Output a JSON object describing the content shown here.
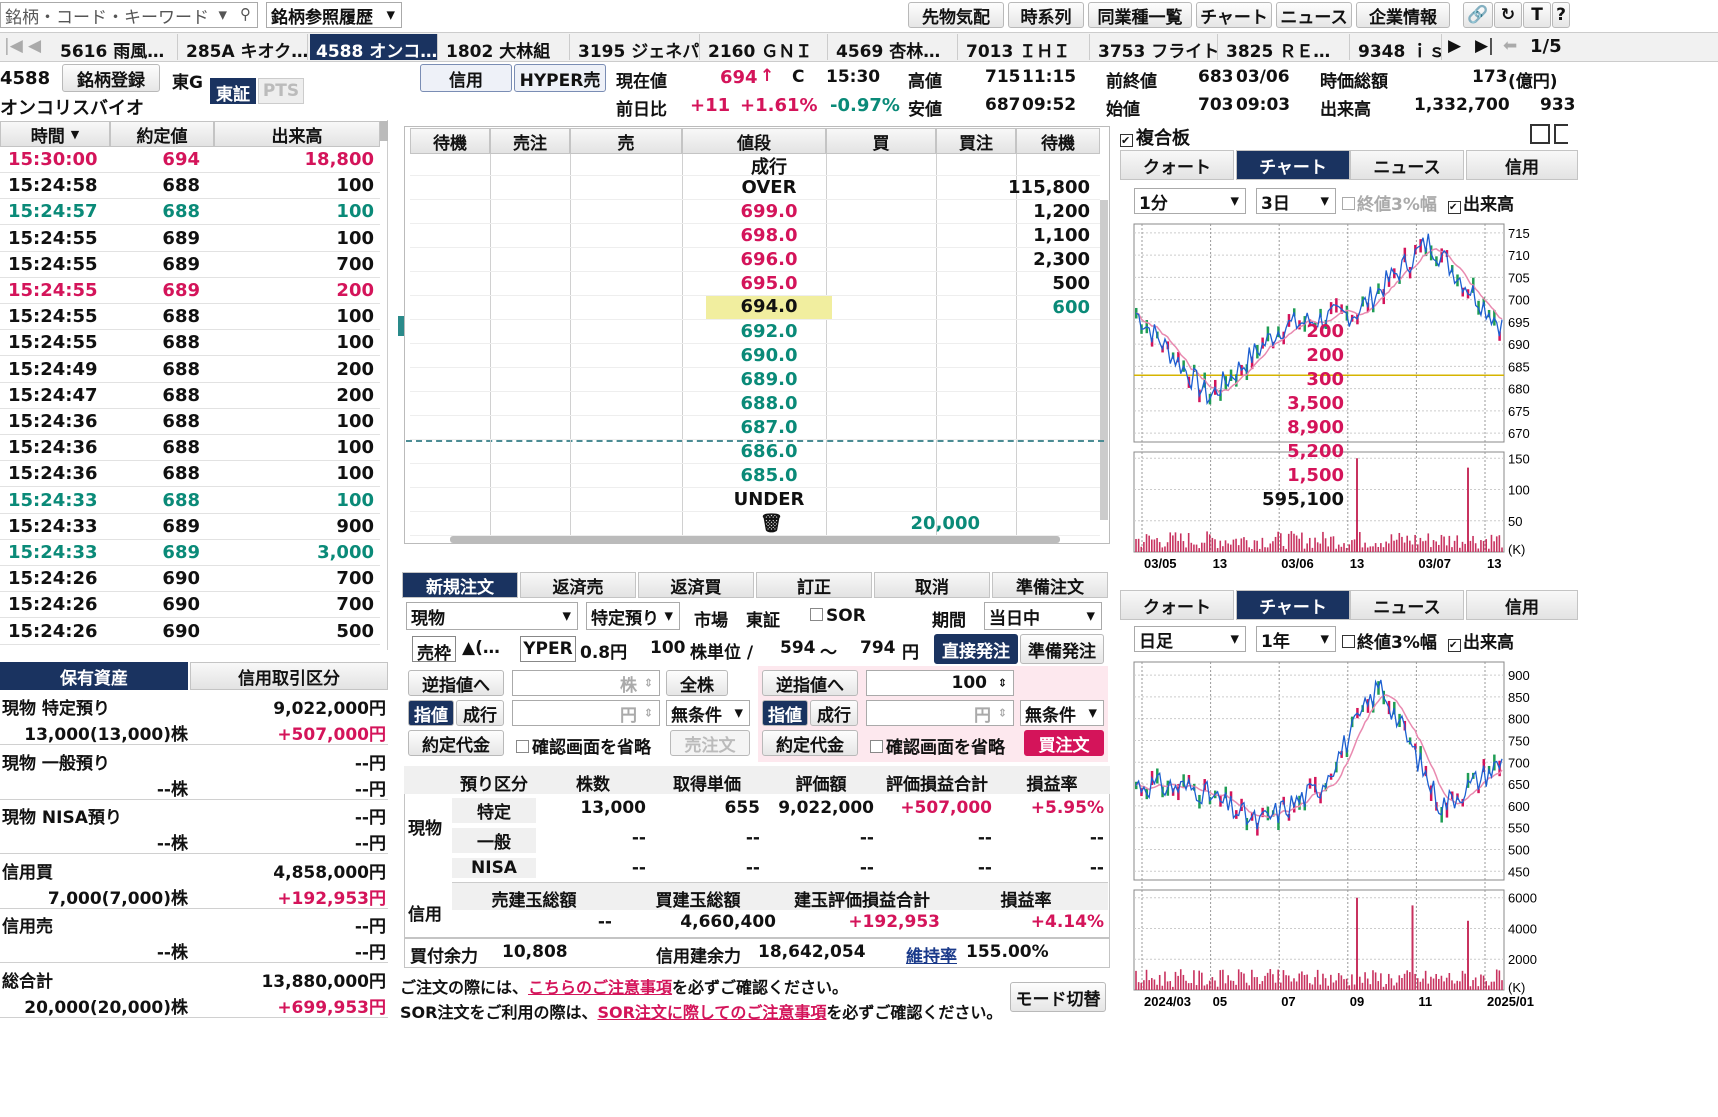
{
  "search": {
    "placeholder": "銘柄・コード・キーワード",
    "history": "銘柄参照履歴"
  },
  "topnav": [
    "先物気配",
    "時系列",
    "同業種一覧",
    "チャート",
    "ニュース",
    "企業情報"
  ],
  "tickers": [
    "5616 雨風…",
    "285A キオク…",
    "4588 オンコ…",
    "1802 大林組",
    "3195 ジェネパ",
    "2160 ＧＮＩ",
    "4569 杏林…",
    "7013 ＩＨＩ",
    "3753 フライト",
    "3825 ＲＥ…",
    "9348 ｉｓ"
  ],
  "pager": "1/5",
  "stock": {
    "code": "4588",
    "name": "オンコリスバイオ",
    "register": "銘柄登録",
    "market_label": "東G",
    "market_tab": "東証",
    "pts": "PTS",
    "credit": "信用",
    "hyper": "HYPER売"
  },
  "quote": {
    "cur_label": "現在値",
    "cur": "694",
    "cur_arrow": "↑",
    "c": "C",
    "cur_time": "15:30",
    "diff_label": "前日比",
    "diff": "+11",
    "diff_pct": "+1.61%",
    "vwap_pct": "-0.97%",
    "high_label": "高値",
    "high": "715",
    "high_time": "11:15",
    "low_label": "安値",
    "low": "687",
    "low_time": "09:52",
    "prev_label": "前終値",
    "prev": "683",
    "prev_date": "03/06",
    "open_label": "始値",
    "open": "703",
    "open_time": "09:03",
    "mcap_label": "時価総額",
    "mcap": "173",
    "mcap_unit": "(億円)",
    "vol_label": "出来高",
    "vol": "1,332,700",
    "vol_extra": "933"
  },
  "timesales": {
    "headers": [
      "時間",
      "約定値",
      "出来高"
    ],
    "rows": [
      [
        "15:30:00",
        "694",
        "18,800",
        "red"
      ],
      [
        "15:24:58",
        "688",
        "100",
        ""
      ],
      [
        "15:24:57",
        "688",
        "100",
        "grn"
      ],
      [
        "15:24:55",
        "689",
        "100",
        ""
      ],
      [
        "15:24:55",
        "689",
        "700",
        ""
      ],
      [
        "15:24:55",
        "689",
        "200",
        "red"
      ],
      [
        "15:24:55",
        "688",
        "100",
        ""
      ],
      [
        "15:24:55",
        "688",
        "100",
        ""
      ],
      [
        "15:24:49",
        "688",
        "200",
        ""
      ],
      [
        "15:24:47",
        "688",
        "200",
        ""
      ],
      [
        "15:24:36",
        "688",
        "100",
        ""
      ],
      [
        "15:24:36",
        "688",
        "100",
        ""
      ],
      [
        "15:24:36",
        "688",
        "100",
        ""
      ],
      [
        "15:24:33",
        "688",
        "100",
        "grn"
      ],
      [
        "15:24:33",
        "689",
        "900",
        ""
      ],
      [
        "15:24:33",
        "689",
        "3,000",
        "grn"
      ],
      [
        "15:24:26",
        "690",
        "700",
        ""
      ],
      [
        "15:24:26",
        "690",
        "700",
        ""
      ],
      [
        "15:24:26",
        "690",
        "500",
        ""
      ]
    ]
  },
  "board": {
    "headers": [
      "待機",
      "売注",
      "売",
      "値段",
      "買",
      "買注",
      "待機"
    ],
    "rows": [
      [
        "",
        "",
        "",
        "成行",
        "",
        ""
      ],
      [
        "",
        "",
        "115,800",
        "OVER",
        "",
        ""
      ],
      [
        "",
        "",
        "1,200",
        "699.0",
        "",
        "red"
      ],
      [
        "",
        "",
        "1,100",
        "698.0",
        "",
        "red"
      ],
      [
        "",
        "",
        "2,300",
        "696.0",
        "",
        "red"
      ],
      [
        "",
        "",
        "500",
        "695.0",
        "",
        "red"
      ],
      [
        "",
        "",
        "600",
        "694.0",
        "",
        "cur"
      ],
      [
        "",
        "",
        "",
        "692.0",
        "200",
        "grn"
      ],
      [
        "",
        "",
        "",
        "690.0",
        "200",
        "grn"
      ],
      [
        "",
        "",
        "",
        "689.0",
        "300",
        "grn"
      ],
      [
        "",
        "",
        "",
        "688.0",
        "3,500",
        "grn"
      ],
      [
        "",
        "",
        "",
        "687.0",
        "8,900",
        "grn"
      ],
      [
        "",
        "",
        "",
        "686.0",
        "5,200",
        "grn"
      ],
      [
        "",
        "",
        "",
        "685.0",
        "1,500",
        "grn"
      ],
      [
        "",
        "",
        "",
        "UNDER",
        "595,100",
        ""
      ],
      [
        "",
        "20,000",
        "",
        "",
        "",
        ""
      ]
    ]
  },
  "orders": {
    "tabs": [
      "新規注文",
      "返済売",
      "返済買",
      "訂正",
      "取消",
      "準備注文"
    ],
    "acct": "現物",
    "spec": "特定預り",
    "market_lbl": "市場",
    "market": "東証",
    "sor": "SOR",
    "period_lbl": "期間",
    "period": "当日中",
    "sell_tag": "売枠",
    "sell_tri": "▲(…",
    "yper": "YPER",
    "yper_val": "0.8円",
    "unit": "100",
    "unit_lbl": "株単位 /",
    "range_lo": "594",
    "range_sep": "〜",
    "range_hi": "794",
    "yen": "円",
    "direct": "直接発注",
    "prep": "準備発注",
    "sell": {
      "gyaku": "逆指値へ",
      "qty_ph": "株",
      "all": "全株",
      "limit": "指値",
      "market": "成行",
      "price_ph": "円",
      "cond": "無条件",
      "amount": "約定代金",
      "skip": "確認画面を省略",
      "submit": "売注文"
    },
    "buy": {
      "gyaku": "逆指値へ",
      "qty": "100",
      "limit": "指値",
      "market": "成行",
      "price_ph": "円",
      "cond": "無条件",
      "amount": "約定代金",
      "skip": "確認画面を省略",
      "submit": "買注文"
    }
  },
  "holdings": {
    "headers": [
      "預り区分",
      "株数",
      "取得単価",
      "評価額",
      "評価損益合計",
      "損益率"
    ],
    "spot_lbl": "現物",
    "rows": [
      [
        "特定",
        "13,000",
        "655",
        "9,022,000",
        "+507,000",
        "+5.95%"
      ],
      [
        "一般",
        "--",
        "--",
        "--",
        "--",
        "--"
      ],
      [
        "NISA",
        "--",
        "--",
        "--",
        "--",
        "--"
      ]
    ],
    "credit_lbl": "信用",
    "credit_headers": [
      "売建玉総額",
      "買建玉総額",
      "建玉評価損益合計",
      "損益率"
    ],
    "credit_row": [
      "--",
      "4,660,400",
      "+192,953",
      "+4.14%"
    ],
    "buying_power_lbl": "買付余力",
    "buying_power": "10,808",
    "credit_power_lbl": "信用建余力",
    "credit_power": "18,642,054",
    "maint_lbl": "維持率",
    "maint": "155.00%"
  },
  "notice": {
    "line1a": "ご注文の際には、",
    "line1b": "こちらのご注意事項",
    "line1c": "を必ずご確認ください。",
    "line2a": "SOR注文をご利用の際は、",
    "line2b": "SOR注文に際してのご注意事項",
    "line2c": "を必ずご確認ください。",
    "mode": "モード切替"
  },
  "assets": {
    "tabs": [
      "保有資産",
      "信用取引区分"
    ],
    "rows": [
      [
        "現物 特定預り",
        "9,022,000円",
        "13,000(13,000)株",
        "+507,000円"
      ],
      [
        "現物 一般預り",
        "--円",
        "--株",
        "--円"
      ],
      [
        "現物 NISA預り",
        "--円",
        "--株",
        "--円"
      ],
      [
        "信用買",
        "4,858,000円",
        "7,000(7,000)株",
        "+192,953円"
      ],
      [
        "信用売",
        "--円",
        "--株",
        "--円"
      ],
      [
        "総合計",
        "13,880,000円",
        "20,000(20,000)株",
        "+699,953円"
      ]
    ]
  },
  "fukugo": "複合板",
  "panel_tabs": [
    "クォート",
    "チャート",
    "ニュース",
    "信用"
  ],
  "chart1": {
    "interval": "1分",
    "span": "3日",
    "opt1": "終値3%幅",
    "opt2": "出来高",
    "yticks": [
      "715",
      "710",
      "705",
      "700",
      "695",
      "690",
      "685",
      "680",
      "675",
      "670"
    ],
    "vticks": [
      "150",
      "100",
      "50"
    ],
    "vunit": "(K)",
    "xticks": [
      "03/05",
      "13",
      "03/06",
      "13",
      "03/07",
      "13"
    ]
  },
  "chart2": {
    "interval": "日足",
    "span": "1年",
    "opt1": "終値3%幅",
    "opt2": "出来高",
    "yticks": [
      "900",
      "850",
      "800",
      "750",
      "700",
      "650",
      "600",
      "550",
      "500",
      "450"
    ],
    "vticks": [
      "6000",
      "4000",
      "2000"
    ],
    "vunit": "(K)",
    "xticks": [
      "2024/03",
      "05",
      "07",
      "09",
      "11",
      "2025/01"
    ]
  },
  "chart_data": [
    {
      "type": "line",
      "title": "",
      "xlabel": "",
      "ylabel": "",
      "x": [
        "03/05",
        "03/05 13",
        "03/06",
        "03/06 13",
        "03/07",
        "03/07 13"
      ],
      "series": [
        {
          "values": [
            697,
            678,
            694,
            697,
            713,
            694
          ]
        }
      ],
      "ylim": [
        668,
        717
      ],
      "hline": 683,
      "volume": {
        "ylim": [
          0,
          160
        ],
        "spikes": [
          150,
          135
        ]
      }
    },
    {
      "type": "line",
      "title": "",
      "xlabel": "",
      "ylabel": "",
      "x": [
        "2024/03",
        "05",
        "07",
        "09",
        "11",
        "2025/01"
      ],
      "series": [
        {
          "values": [
            650,
            640,
            560,
            640,
            880,
            600,
            700
          ]
        }
      ],
      "ylim": [
        430,
        930
      ],
      "volume": {
        "ylim": [
          0,
          6500
        ],
        "spikes": [
          6000,
          5500,
          4500
        ]
      }
    }
  ]
}
